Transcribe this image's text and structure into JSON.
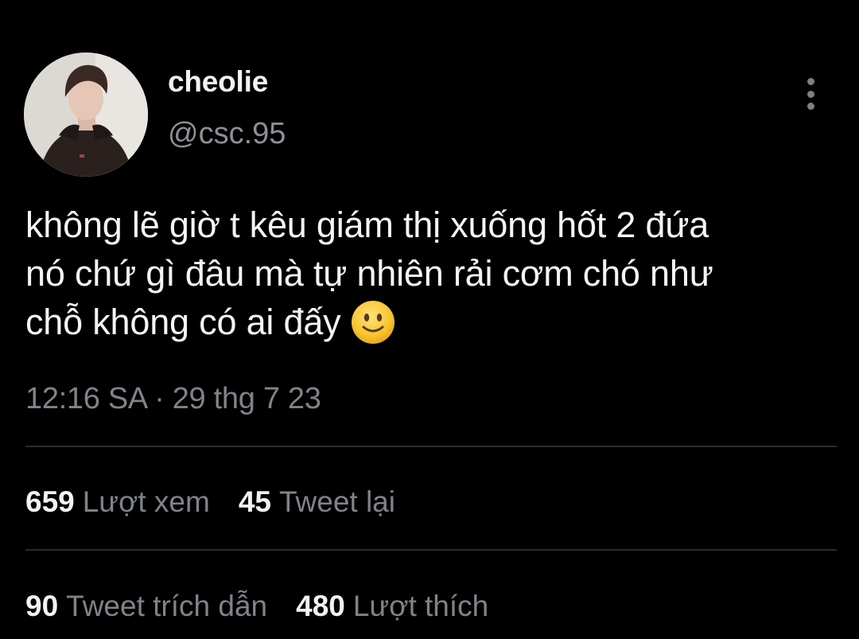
{
  "tweet": {
    "display_name": "cheolie",
    "handle": "@csc.95",
    "text_lines": [
      "không lẽ giờ t kêu giám thị xuống hốt 2 đứa",
      "nó chứ gì đâu mà tự nhiên rải cơm chó như",
      "chỗ không có ai đấy"
    ],
    "emoji": "slightly-smiling-face",
    "timestamp": "12:16 SA · 29 thg 7 23"
  },
  "stats_row_1": [
    {
      "value": "659",
      "label": "Lượt xem"
    },
    {
      "value": "45",
      "label": "Tweet lại"
    }
  ],
  "stats_row_2": [
    {
      "value": "90",
      "label": "Tweet trích dẫn"
    },
    {
      "value": "480",
      "label": "Lượt thích"
    }
  ],
  "colors": {
    "background": "#000000",
    "text_primary": "#f4f4f4",
    "text_secondary": "#7f848a",
    "divider": "#2a2d30",
    "emoji_yellow": "#f7c531"
  }
}
